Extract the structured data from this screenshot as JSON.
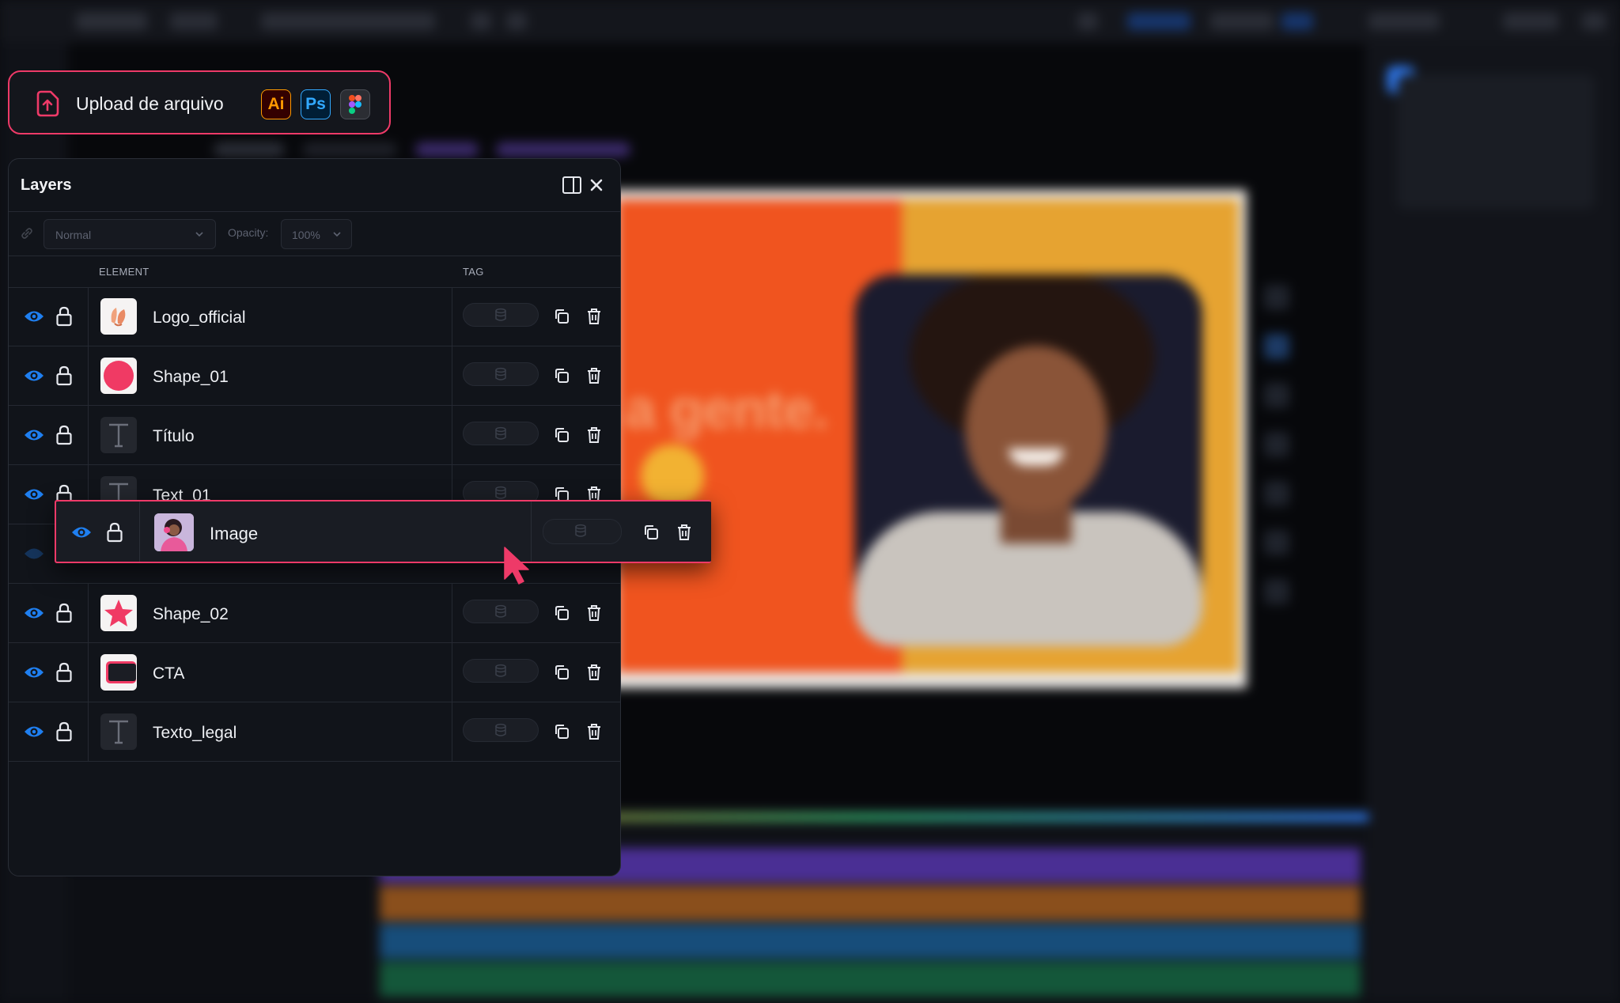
{
  "upload": {
    "label": "Upload de arquivo",
    "badges": [
      {
        "id": "ai",
        "text": "Ai",
        "color": "#ff9a00"
      },
      {
        "id": "ps",
        "text": "Ps",
        "color": "#31a8ff"
      },
      {
        "id": "figma",
        "icon": "figma-icon"
      }
    ],
    "accent": "#ee3a68"
  },
  "panel": {
    "title": "Layers",
    "toolbar": {
      "blend_mode": "Normal",
      "opacity_label": "Opacity:",
      "opacity_value": "100%"
    },
    "columns": {
      "element": "ELEMENT",
      "tag": "TAG"
    },
    "layers": [
      {
        "name": "Logo_official",
        "thumb": "logo"
      },
      {
        "name": "Shape_01",
        "thumb": "circle"
      },
      {
        "name": "Título",
        "thumb": "text"
      },
      {
        "name": "Text_01",
        "thumb": "text"
      },
      {
        "name": "Shape_02",
        "thumb": "star"
      },
      {
        "name": "CTA",
        "thumb": "cta"
      },
      {
        "name": "Texto_legal",
        "thumb": "text"
      }
    ],
    "dragging": {
      "name": "Image",
      "thumb": "image"
    }
  },
  "canvas": {
    "headline_fragment": "a gente."
  },
  "colors": {
    "accent_blue": "#1f7ff0",
    "shape_pink": "#f03a64",
    "panel_bg": "#11141a"
  }
}
